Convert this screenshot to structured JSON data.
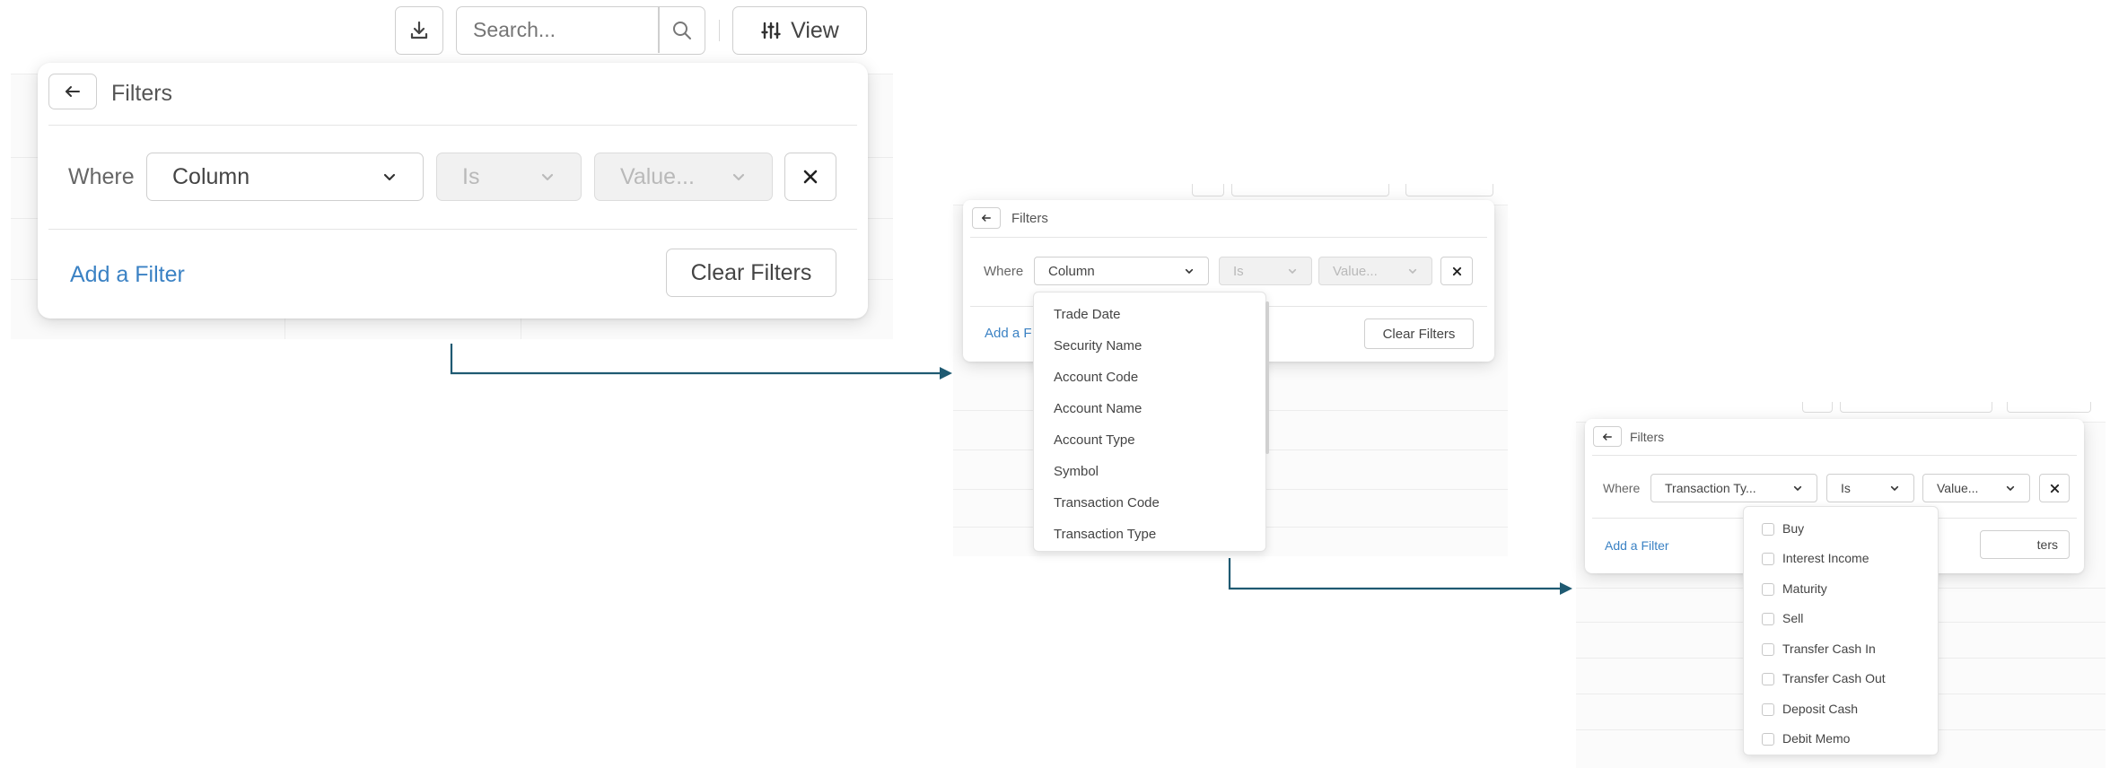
{
  "toolbar": {
    "search_placeholder": "Search...",
    "view_label": "View"
  },
  "panel1": {
    "title": "Filters",
    "where_label": "Where",
    "column_value": "Column",
    "operator_value": "Is",
    "value_placeholder": "Value...",
    "add_filter_label": "Add a Filter",
    "clear_filters_label": "Clear Filters"
  },
  "panel2": {
    "title": "Filters",
    "where_label": "Where",
    "column_value": "Column",
    "operator_value": "Is",
    "value_placeholder": "Value...",
    "add_filter_label": "Add a F",
    "clear_filters_label": "Clear Filters",
    "column_options": [
      "Trade Date",
      "Security Name",
      "Account Code",
      "Account Name",
      "Account Type",
      "Symbol",
      "Transaction Code",
      "Transaction Type"
    ]
  },
  "panel3": {
    "title": "Filters",
    "where_label": "Where",
    "column_value": "Transaction Ty...",
    "operator_value": "Is",
    "value_placeholder": "Value...",
    "add_filter_label": "Add a Filter",
    "clear_filters_label": "ters",
    "value_options": [
      "Buy",
      "Interest Income",
      "Maturity",
      "Sell",
      "Transfer Cash In",
      "Transfer Cash Out",
      "Deposit Cash",
      "Debit Memo"
    ]
  },
  "colors": {
    "accent_link": "#3b82c4",
    "arrow": "#1f5a72"
  },
  "icons": [
    "download-icon",
    "search-icon",
    "sliders-icon",
    "back-arrow-icon",
    "chevron-down-icon",
    "close-icon",
    "checkbox-icon"
  ]
}
